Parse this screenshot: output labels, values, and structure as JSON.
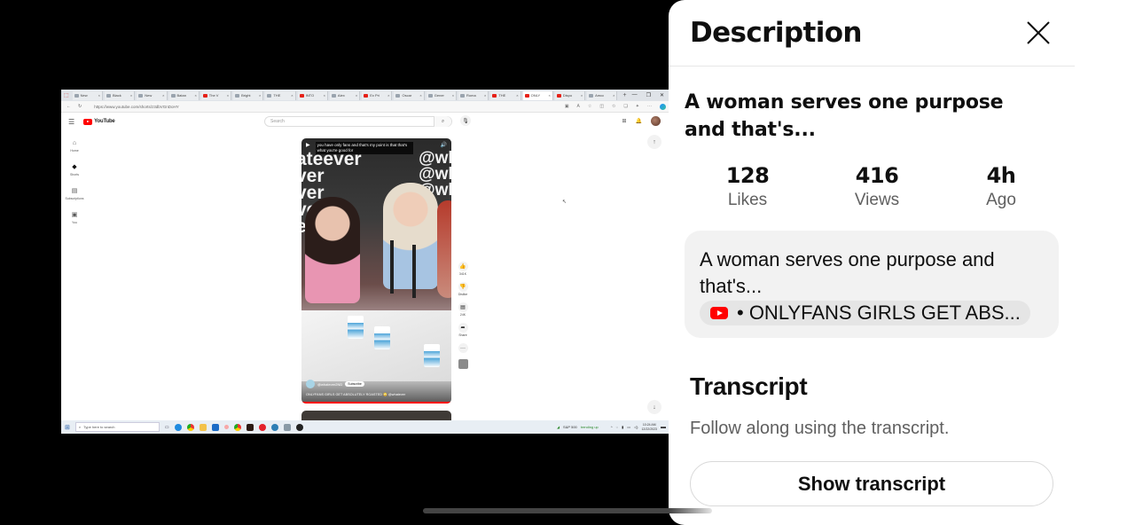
{
  "recording": {
    "browser_tabs": [
      {
        "label": "New",
        "icon": "page-icon"
      },
      {
        "label": "Black",
        "icon": "page-icon"
      },
      {
        "label": "New",
        "icon": "page-icon"
      },
      {
        "label": "Batan",
        "icon": "page-icon"
      },
      {
        "label": "The V",
        "icon": "youtube-icon"
      },
      {
        "label": "Bright",
        "icon": "page-icon"
      },
      {
        "label": "THE",
        "icon": "page-icon"
      },
      {
        "label": "INTO",
        "icon": "youtube-icon"
      },
      {
        "label": "Alex",
        "icon": "page-icon"
      },
      {
        "label": "Ex Pri",
        "icon": "youtube-icon"
      },
      {
        "label": "Oscar",
        "icon": "page-icon"
      },
      {
        "label": "Gener",
        "icon": "page-icon"
      },
      {
        "label": "Roma",
        "icon": "page-icon"
      },
      {
        "label": "THE",
        "icon": "youtube-icon"
      },
      {
        "label": "ONLY",
        "icon": "youtube-icon",
        "active": true
      },
      {
        "label": "Dispo",
        "icon": "youtube-icon"
      },
      {
        "label": "Amcc",
        "icon": "page-icon"
      }
    ],
    "url": "https://www.youtube.com/shorts/z3dbVGnDoHY",
    "youtube": {
      "logo_text": "YouTube",
      "search_placeholder": "Search",
      "sidenav": [
        {
          "label": "Home",
          "icon": "home-icon"
        },
        {
          "label": "Shorts",
          "icon": "shorts-icon"
        },
        {
          "label": "Subscriptions",
          "icon": "subscriptions-icon"
        },
        {
          "label": "You",
          "icon": "you-icon"
        }
      ],
      "short": {
        "caption": "you have only fans and that's my point is that that's what you're good for",
        "bg_text_left": "ateever\nver\nver\nver\never",
        "bg_text_right": "@wh\n@wh\n@wh",
        "channel": "@whatever2ND",
        "subscribe_label": "Subscribe",
        "title": "ONLYFANS GIRLS GET ABSOLUTELY ROASTED 😳 @whatever"
      },
      "actions": [
        {
          "icon": "like-icon",
          "label": "341K"
        },
        {
          "icon": "dislike-icon",
          "label": "Dislike"
        },
        {
          "icon": "comments-icon",
          "label": "24K"
        },
        {
          "icon": "share-icon",
          "label": "Share"
        },
        {
          "icon": "more-icon",
          "label": ""
        }
      ]
    },
    "taskbar": {
      "search_placeholder": "Type here to search",
      "market_label": "S&P 500",
      "market_status": "trending up",
      "time": "10:24 AM",
      "date": "12/22/2023"
    }
  },
  "sheet": {
    "title": "Description",
    "video_title": "A woman serves one purpose and that's...",
    "stats": [
      {
        "value": "128",
        "label": "Likes"
      },
      {
        "value": "416",
        "label": "Views"
      },
      {
        "value": "4h",
        "label": "Ago"
      }
    ],
    "description_text": "A woman serves one purpose and that's...",
    "source_chip": "• ONLYFANS GIRLS GET ABS...",
    "transcript": {
      "title": "Transcript",
      "subtitle": "Follow along using the transcript.",
      "button_label": "Show transcript"
    }
  },
  "colors": {
    "youtube_red": "#ff0000",
    "sheet_bg": "#ffffff",
    "card_bg": "#f2f2f2",
    "secondary_text": "#606060"
  }
}
